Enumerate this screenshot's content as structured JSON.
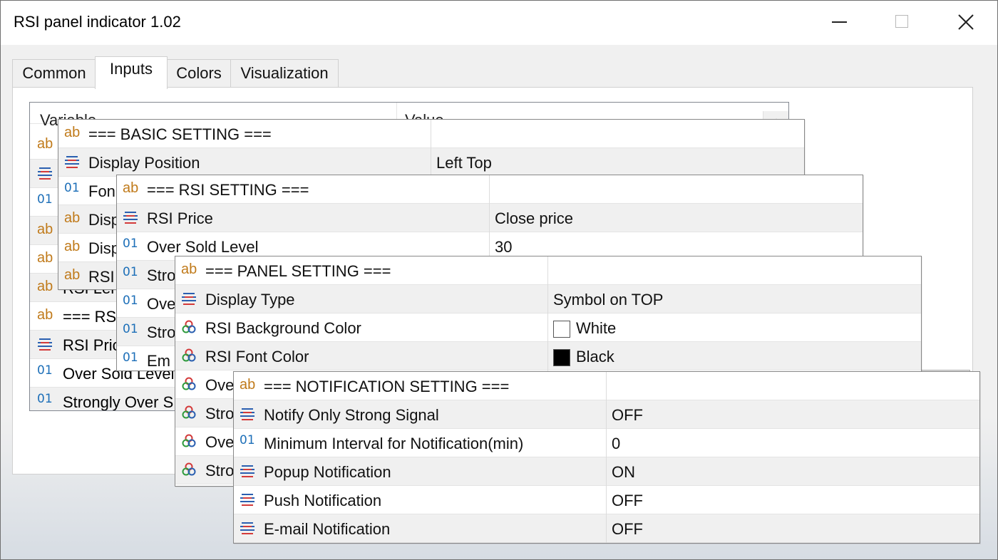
{
  "window": {
    "title": "RSI panel indicator 1.02"
  },
  "tabs": [
    {
      "label": "Common"
    },
    {
      "label": "Inputs"
    },
    {
      "label": "Colors"
    },
    {
      "label": "Visualization"
    }
  ],
  "grid": {
    "col_variable": "Variable",
    "col_value": "Value",
    "rows": [
      {
        "icon": "ab",
        "text": "ab"
      },
      {
        "icon": "list",
        "text": ""
      },
      {
        "icon": "01",
        "text": ""
      },
      {
        "icon": "ab",
        "text": ""
      },
      {
        "icon": "ab",
        "text": ""
      },
      {
        "icon": "ab",
        "text": "RSI Len"
      },
      {
        "icon": "ab",
        "text": "=== RS"
      },
      {
        "icon": "list",
        "text": "RSI Pric"
      },
      {
        "icon": "01",
        "text": "Over Sold Level"
      },
      {
        "icon": "01",
        "text": "Strongly Over S"
      }
    ]
  },
  "panel_basic": {
    "rows": [
      {
        "icon": "ab",
        "name": "=== BASIC SETTING ===",
        "value": ""
      },
      {
        "icon": "list",
        "name": "Display Position",
        "value": "Left Top"
      },
      {
        "icon": "01",
        "name": "Fon",
        "value": ""
      },
      {
        "icon": "ab",
        "name": "Disp",
        "value": ""
      },
      {
        "icon": "ab",
        "name": "Disp",
        "value": ""
      },
      {
        "icon": "ab",
        "name": "RSI",
        "value": ""
      }
    ]
  },
  "panel_rsi": {
    "rows": [
      {
        "icon": "ab",
        "name": "=== RSI SETTING ===",
        "value": ""
      },
      {
        "icon": "list",
        "name": "RSI Price",
        "value": "Close price"
      },
      {
        "icon": "01",
        "name": "Over Sold Level",
        "value": "30"
      },
      {
        "icon": "01",
        "name": "Stro",
        "value": ""
      },
      {
        "icon": "01",
        "name": "Ove",
        "value": ""
      },
      {
        "icon": "01",
        "name": "Stro",
        "value": ""
      },
      {
        "icon": "01",
        "name": "Em",
        "value": ""
      }
    ]
  },
  "panel_panel": {
    "rows": [
      {
        "icon": "ab",
        "name": "=== PANEL SETTING ===",
        "value": ""
      },
      {
        "icon": "list",
        "name": "Display Type",
        "value": "Symbol on TOP"
      },
      {
        "icon": "color",
        "name": "RSI Background Color",
        "value": "White",
        "swatch": "#ffffff"
      },
      {
        "icon": "color",
        "name": "RSI Font Color",
        "value": "Black",
        "swatch": "#000000"
      },
      {
        "icon": "color",
        "name": "Ove",
        "value": ""
      },
      {
        "icon": "color",
        "name": "Stro",
        "value": ""
      },
      {
        "icon": "color",
        "name": "Ove",
        "value": ""
      },
      {
        "icon": "color",
        "name": "Stro",
        "value": ""
      }
    ]
  },
  "panel_notify": {
    "rows": [
      {
        "icon": "ab",
        "name": "=== NOTIFICATION SETTING ===",
        "value": ""
      },
      {
        "icon": "list",
        "name": "Notify Only Strong Signal",
        "value": "OFF"
      },
      {
        "icon": "01",
        "name": "Minimum Interval for Notification(min)",
        "value": "0"
      },
      {
        "icon": "list",
        "name": "Popup Notification",
        "value": "ON"
      },
      {
        "icon": "list",
        "name": "Push Notification",
        "value": "OFF"
      },
      {
        "icon": "list",
        "name": "E-mail Notification",
        "value": "OFF"
      }
    ]
  },
  "colors": {
    "ab_icon": "#c07a1a",
    "num_icon": "#1d6fb8",
    "list_icon_blue": "#2a5fb0",
    "list_icon_red": "#d33a3a"
  }
}
